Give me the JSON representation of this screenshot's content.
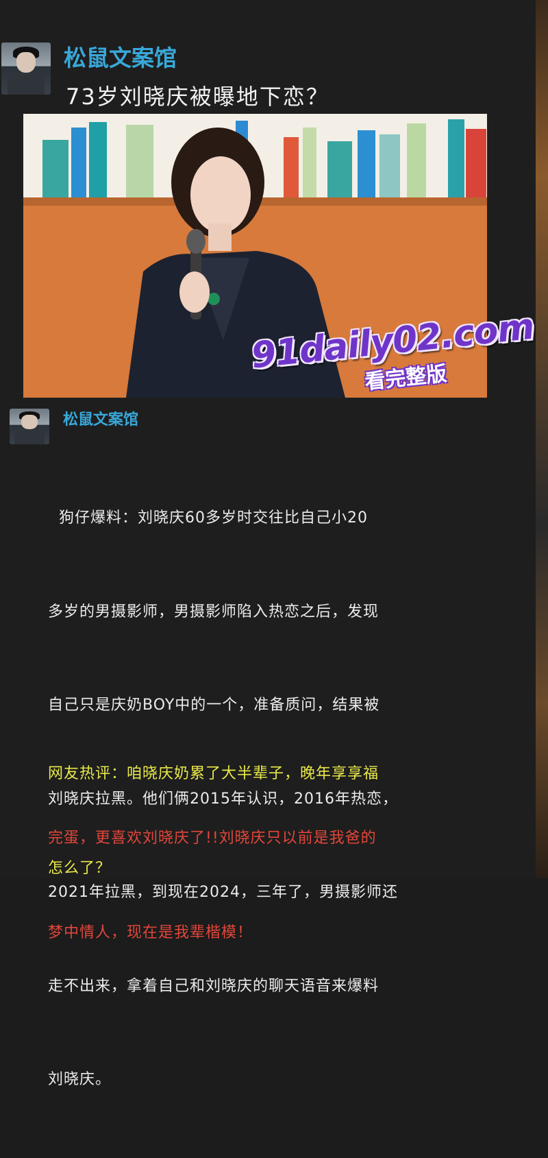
{
  "account": {
    "name": "松鼠文案馆"
  },
  "post": {
    "headline": "73岁刘晓庆被曝地下恋？",
    "body_lines": [
      "  狗仔爆料：刘晓庆60多岁时交往比自己小20",
      "多岁的男摄影师，男摄影师陷入热恋之后，发现",
      "自己只是庆奶BOY中的一个，准备质问，结果被",
      "刘晓庆拉黑。他们俩2015年认识，2016年热恋，",
      "2021年拉黑，到现在2024，三年了，男摄影师还",
      "走不出来，拿着自己和刘晓庆的聊天语音来爆料",
      "刘晓庆。"
    ],
    "comment_yellow_lines": [
      "网友热评：咱晓庆奶累了大半辈子，晚年享享福",
      "怎么了？"
    ],
    "comment_red_lines": [
      "完蛋，更喜欢刘晓庆了!!刘晓庆只以前是我爸的",
      "梦中情人，现在是我辈楷模！"
    ]
  },
  "watermark": {
    "site": "91daily02.com",
    "tagline": "看完整版"
  },
  "colors": {
    "name": "#39a7d8",
    "yellow": "#e9e94a",
    "red": "#e2463a",
    "background": "#1e1e1e"
  }
}
